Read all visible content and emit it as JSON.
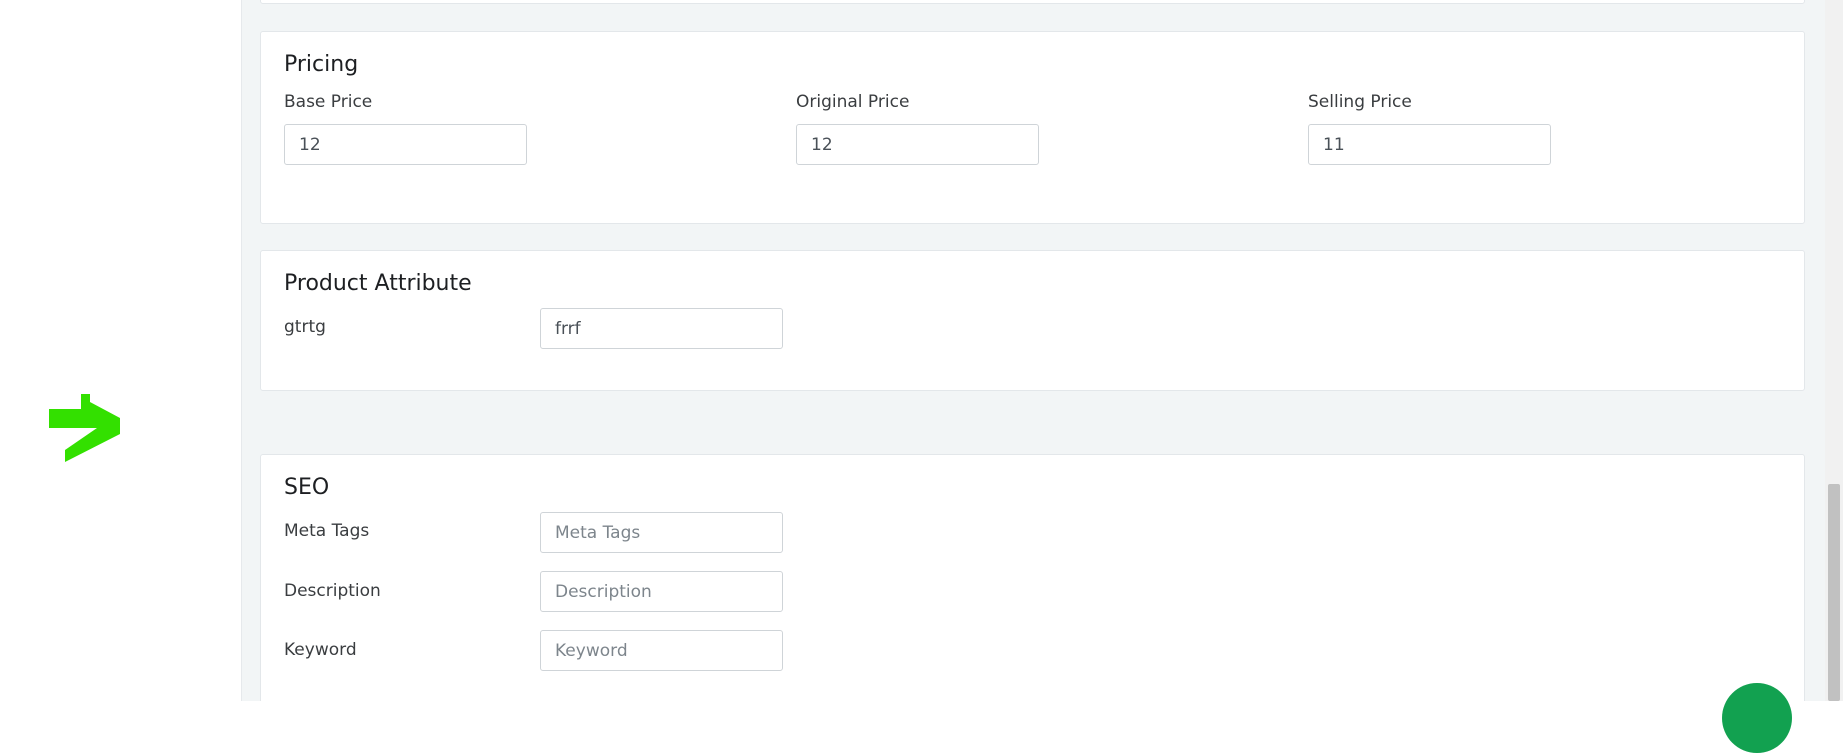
{
  "pricing": {
    "title": "Pricing",
    "base_price": {
      "label": "Base Price",
      "value": "12"
    },
    "original_price": {
      "label": "Original Price",
      "value": "12"
    },
    "selling_price": {
      "label": "Selling Price",
      "value": "11"
    }
  },
  "product_attribute": {
    "title": "Product Attribute",
    "items": [
      {
        "label": "gtrtg",
        "value": "frrf"
      }
    ]
  },
  "seo": {
    "title": "SEO",
    "meta_tags": {
      "label": "Meta Tags",
      "placeholder": "Meta Tags"
    },
    "description": {
      "label": "Description",
      "placeholder": "Description"
    },
    "keyword": {
      "label": "Keyword",
      "placeholder": "Keyword"
    }
  },
  "colors": {
    "logo": "#33e000",
    "fab": "#12a150"
  }
}
